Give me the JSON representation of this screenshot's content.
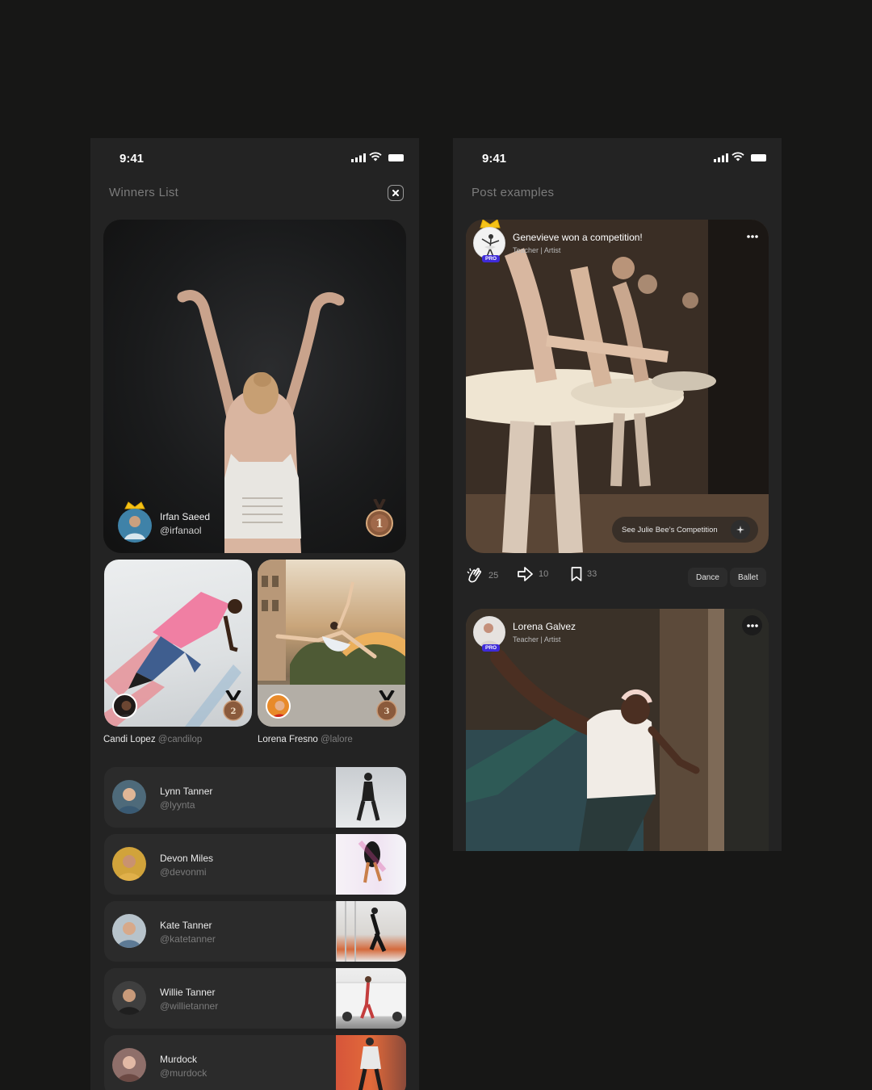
{
  "status_bar": {
    "time": "9:41"
  },
  "winners_screen": {
    "title": "Winners List",
    "first_place": {
      "name": "Irfan Saeed",
      "handle": "@irfanaol",
      "rank": "1"
    },
    "runners_up": [
      {
        "name": "Candi Lopez",
        "handle": "@candilop",
        "rank": "2"
      },
      {
        "name": "Lorena Fresno",
        "handle": "@lalore",
        "rank": "3"
      }
    ],
    "list": [
      {
        "name": "Lynn Tanner",
        "handle": "@lyynta"
      },
      {
        "name": "Devon Miles",
        "handle": "@devonmi"
      },
      {
        "name": "Kate Tanner",
        "handle": "@katetanner"
      },
      {
        "name": "Willie Tanner",
        "handle": "@willietanner"
      },
      {
        "name": "Murdock",
        "handle": "@murdock"
      }
    ]
  },
  "posts_screen": {
    "title": "Post examples",
    "posts": [
      {
        "title": "Genevieve won a competition!",
        "subtitle": "Teacher  |  Artist",
        "badge": "PRO",
        "cta": "See Julie Bee’s Competition",
        "claps": "25",
        "shares": "10",
        "saves": "33",
        "tags": [
          "Dance",
          "Ballet"
        ]
      },
      {
        "title": "Lorena Galvez",
        "subtitle": "Teacher  |  Artist",
        "badge": "PRO"
      }
    ]
  },
  "colors": {
    "background": "#171716",
    "panel": "#232323",
    "card": "#2b2b2b",
    "pro_badge": "#3f2bd9",
    "medal_bronze": "#9a6a4a"
  }
}
